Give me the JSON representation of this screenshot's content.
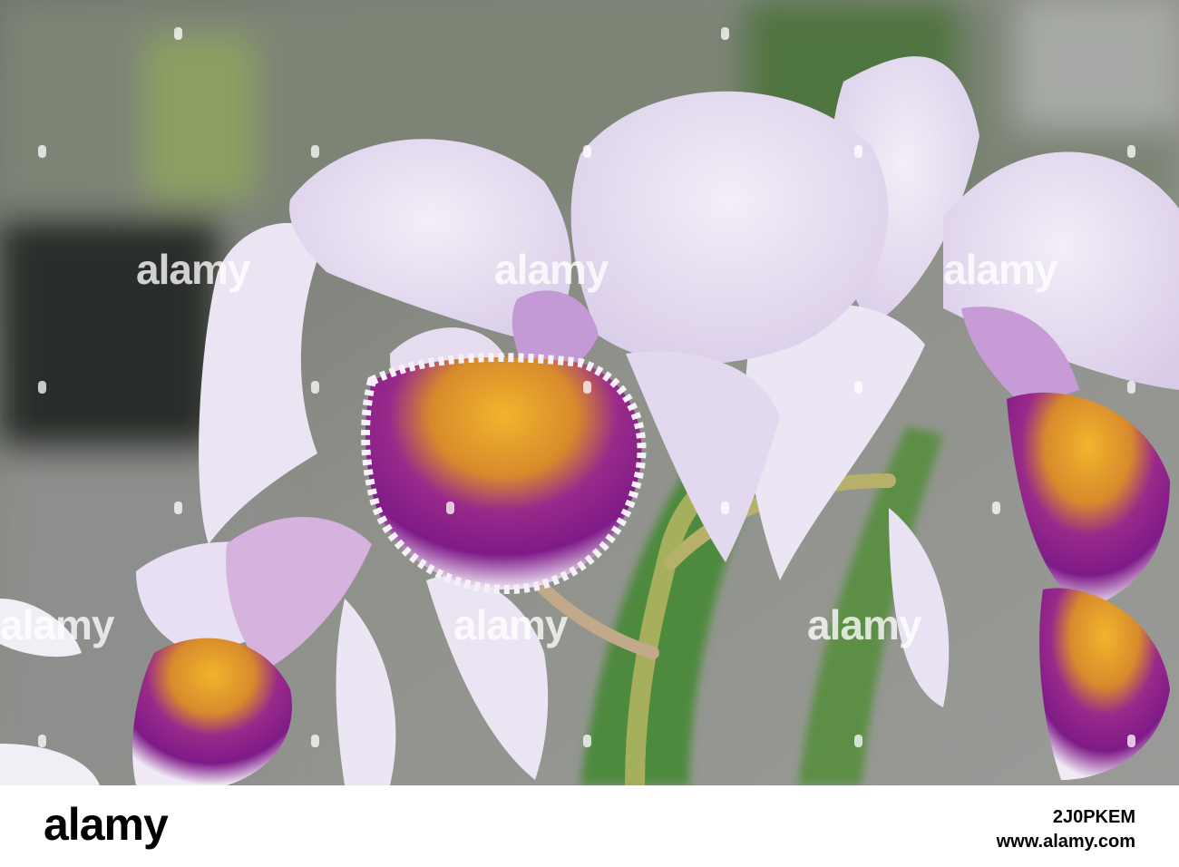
{
  "photo": {
    "subject": "orchids",
    "colors": {
      "background": "#8a8c88",
      "petal": "#e6dcf0",
      "lip_purple": "#8a1f8e",
      "throat_yellow": "#e3a42a",
      "stem_green": "#6f9a55"
    }
  },
  "watermark": {
    "text": "alamy"
  },
  "footer": {
    "logo": "alamy",
    "image_id": "2J0PKEM",
    "url": "www.alamy.com"
  }
}
